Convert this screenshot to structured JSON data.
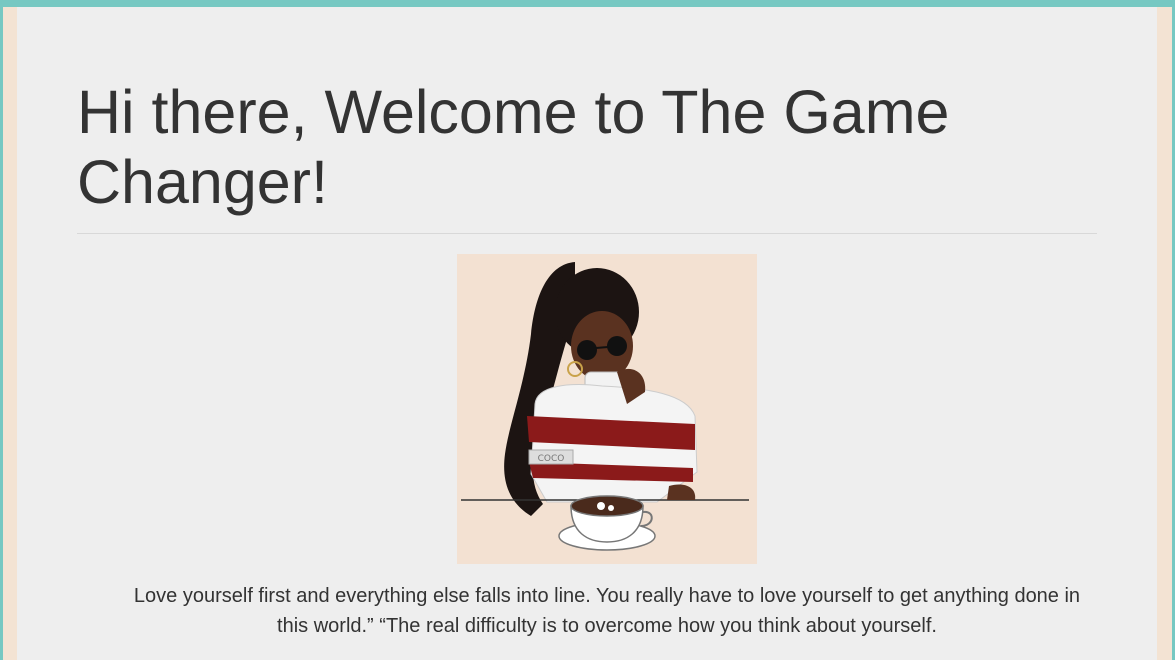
{
  "page": {
    "heading": "Hi there, Welcome to The Game Changer!",
    "quote": "Love yourself first and everything else falls into line. You really have to love yourself to get anything done in this world.” “The real difficulty is to overcome how you think about yourself.",
    "illustration": {
      "sleeve_text": "COCO"
    }
  },
  "colors": {
    "accent_bar": "#76c8c2",
    "page_background": "#f3e3d3",
    "panel_background": "#eeeeee",
    "text": "#333333",
    "sweater_stripe": "#8b1a1a"
  }
}
